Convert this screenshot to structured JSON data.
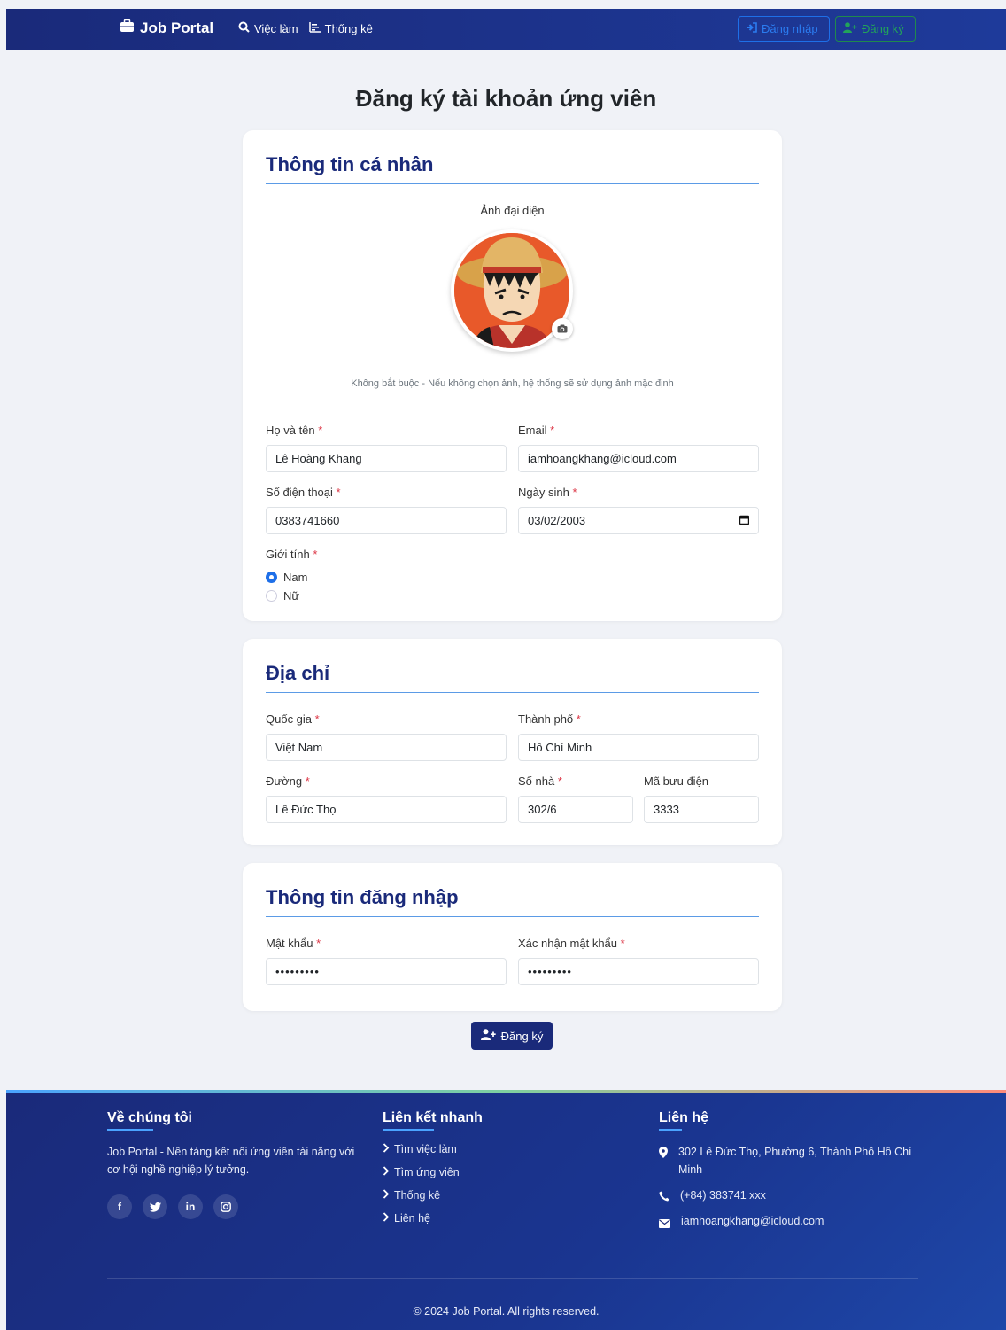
{
  "nav": {
    "brand": "Job Portal",
    "links": [
      "Việc làm",
      "Thống kê"
    ],
    "login": "Đăng nhập",
    "register": "Đăng ký"
  },
  "page_title": "Đăng ký tài khoản ứng viên",
  "personal": {
    "title": "Thông tin cá nhân",
    "avatar_label": "Ảnh đại diện",
    "avatar_hint": "Không bắt buộc - Nếu không chọn ảnh, hệ thống sẽ sử dụng ảnh mặc định",
    "fullname_label": "Họ và tên",
    "fullname_value": "Lê Hoàng Khang",
    "email_label": "Email",
    "email_value": "iamhoangkhang@icloud.com",
    "phone_label": "Số điện thoại",
    "phone_value": "0383741660",
    "dob_label": "Ngày sinh",
    "dob_value": "03/02/2003",
    "gender_label": "Giới tính",
    "gender_options": [
      "Nam",
      "Nữ"
    ],
    "required_mark": "*"
  },
  "address": {
    "title": "Địa chỉ",
    "country_label": "Quốc gia",
    "country_value": "Việt Nam",
    "city_label": "Thành phố",
    "city_value": "Hồ Chí Minh",
    "street_label": "Đường",
    "street_value": "Lê Đức Thọ",
    "house_label": "Số nhà",
    "house_value": "302/6",
    "postal_label": "Mã bưu điện",
    "postal_value": "3333"
  },
  "login_info": {
    "title": "Thông tin đăng nhập",
    "password_label": "Mật khẩu",
    "password_value": "•••••••••",
    "confirm_label": "Xác nhận mật khẩu",
    "confirm_value": "•••••••••"
  },
  "submit_label": "Đăng ký",
  "footer": {
    "about_title": "Về chúng tôi",
    "about_text": "Job Portal - Nền tảng kết nối ứng viên tài năng với cơ hội nghề nghiệp lý tưởng.",
    "social": [
      "f",
      "t",
      "in",
      "ig"
    ],
    "links_title": "Liên kết nhanh",
    "links": [
      "Tìm việc làm",
      "Tìm ứng viên",
      "Thống kê",
      "Liên hệ"
    ],
    "contact_title": "Liên hệ",
    "address": "302 Lê Đức Thọ, Phường 6, Thành Phố Hồ Chí Minh",
    "phone": "(+84) 383741 xxx",
    "email": "iamhoangkhang@icloud.com",
    "copyright": "© 2024 Job Portal. All rights reserved."
  },
  "colors": {
    "primary": "#1a2a7a",
    "accent": "#1e6fe8",
    "required": "#dc3545"
  }
}
